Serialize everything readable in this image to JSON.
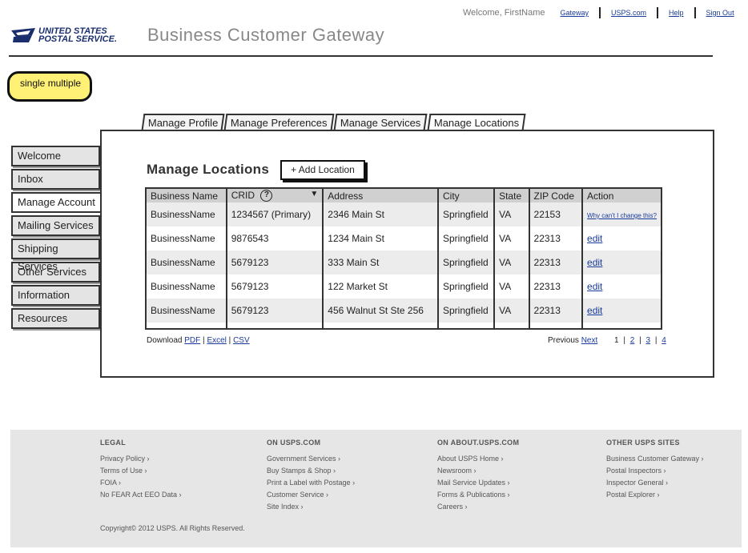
{
  "header": {
    "welcome": "Welcome, FirstName",
    "links": [
      "Gateway",
      "USPS.com",
      "Help",
      "Sign Out"
    ],
    "logo_line1": "UNITED STATES",
    "logo_line2": "POSTAL SERVICE.",
    "title": "Business Customer Gateway"
  },
  "note": {
    "text": "single multiple",
    "color": "#fff176"
  },
  "tabs": [
    "Manage Profile",
    "Manage Preferences",
    "Manage Services",
    "Manage Locations"
  ],
  "active_tab": "Manage Locations",
  "leftnav": {
    "items": [
      "Welcome",
      "Inbox",
      "Manage Account",
      "Mailing Services",
      "Shipping Services",
      "Other Services",
      "Information",
      "Resources"
    ],
    "active": "Manage Account"
  },
  "main": {
    "title": "Manage Locations",
    "add_button": "+ Add Location",
    "table": {
      "columns": [
        "Business Name",
        "CRID",
        "Address",
        "City",
        "State",
        "ZIP Code",
        "Action"
      ],
      "help_icon": "?",
      "rows": [
        {
          "name": "BusinessName",
          "crid": "1234567 (Primary)",
          "address": "2346 Main St",
          "city": "Springfield",
          "state": "VA",
          "zip": "22153",
          "action": "Why can't I change this?"
        },
        {
          "name": "BusinessName",
          "crid": "9876543",
          "address": "1234 Main St",
          "city": "Springfield",
          "state": "VA",
          "zip": "22313",
          "action": "edit"
        },
        {
          "name": "BusinessName",
          "crid": "5679123",
          "address": "333 Main St",
          "city": "Springfield",
          "state": "VA",
          "zip": "22313",
          "action": "edit"
        },
        {
          "name": "BusinessName",
          "crid": "5679123",
          "address": "122 Market St",
          "city": "Springfield",
          "state": "VA",
          "zip": "22313",
          "action": "edit"
        },
        {
          "name": "BusinessName",
          "crid": "5679123",
          "address": "456 Walnut St Ste 256",
          "city": "Springfield",
          "state": "VA",
          "zip": "22313",
          "action": "edit"
        }
      ]
    },
    "download": {
      "label": "Download",
      "pdf": "PDF",
      "excel": "Excel",
      "csv": "CSV"
    },
    "pager": {
      "previous": "Previous",
      "next": "Next",
      "pages": [
        "1",
        "2",
        "3",
        "4"
      ],
      "current": "1"
    }
  },
  "footer": {
    "columns": [
      {
        "heading": "LEGAL",
        "links": [
          "Privacy Policy ›",
          "Terms of Use ›",
          "FOIA ›",
          "No FEAR Act EEO Data ›"
        ]
      },
      {
        "heading": "ON USPS.COM",
        "links": [
          "Government Services ›",
          "Buy Stamps & Shop ›",
          "Print a Label with Postage ›",
          "Customer Service ›",
          "Site Index ›"
        ]
      },
      {
        "heading": "ON ABOUT.USPS.COM",
        "links": [
          "About USPS Home ›",
          "Newsroom ›",
          "Mail Service Updates ›",
          "Forms & Publications ›",
          "Careers ›"
        ]
      },
      {
        "heading": "OTHER USPS SITES",
        "links": [
          "Business Customer Gateway ›",
          "Postal Inspectors ›",
          "Inspector General ›",
          "Postal Explorer ›"
        ]
      }
    ],
    "copyright": "Copyright© 2012 USPS. All Rights Reserved."
  }
}
